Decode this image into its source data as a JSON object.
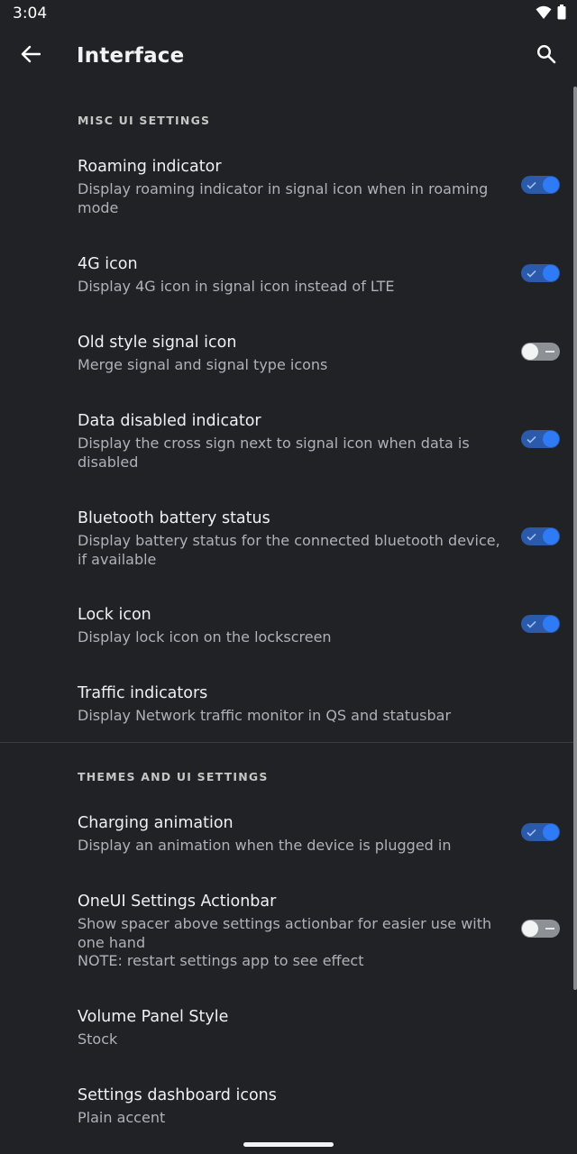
{
  "status_bar": {
    "time": "3:04",
    "icons": [
      "wifi-icon",
      "battery-icon"
    ]
  },
  "app_bar": {
    "title": "Interface",
    "back_icon": "back-arrow-icon",
    "search_icon": "search-icon"
  },
  "sections": [
    {
      "header": "MISC UI SETTINGS",
      "items": [
        {
          "title": "Roaming indicator",
          "summary": "Display roaming indicator in signal icon when in roaming mode",
          "switch": true
        },
        {
          "title": "4G icon",
          "summary": "Display 4G icon in signal icon instead of LTE",
          "switch": true
        },
        {
          "title": "Old style signal icon",
          "summary": "Merge signal and signal type icons",
          "switch": false
        },
        {
          "title": "Data disabled indicator",
          "summary": "Display the cross sign next to signal icon when data is disabled",
          "switch": true
        },
        {
          "title": "Bluetooth battery status",
          "summary": "Display battery status for the connected bluetooth device, if available",
          "switch": true
        },
        {
          "title": "Lock icon",
          "summary": "Display lock icon on the lockscreen",
          "switch": true
        },
        {
          "title": "Traffic indicators",
          "summary": "Display Network traffic monitor in QS and statusbar",
          "switch": null
        }
      ]
    },
    {
      "header": "THEMES AND UI SETTINGS",
      "items": [
        {
          "title": "Charging animation",
          "summary": "Display an animation when the device is plugged in",
          "switch": true
        },
        {
          "title": "OneUI Settings Actionbar",
          "summary_lines": [
            "Show spacer above settings actionbar for easier use with one hand",
            "NOTE: restart settings app to see effect"
          ],
          "switch": false
        },
        {
          "title": "Volume Panel Style",
          "summary": "Stock",
          "switch": null
        },
        {
          "title": "Settings dashboard icons",
          "summary": "Plain accent",
          "switch": null
        }
      ]
    }
  ],
  "colors": {
    "background": "#202226",
    "switch_on_track": "#2a5aa9",
    "switch_on_thumb": "#2f7bf5",
    "switch_off_track": "#8d9094",
    "switch_off_thumb": "#f1f3f4"
  }
}
